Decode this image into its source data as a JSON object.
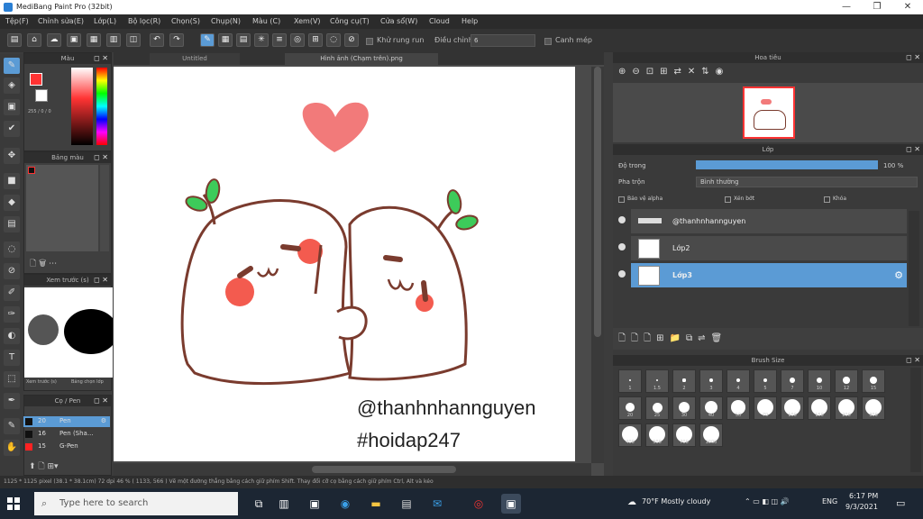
{
  "window": {
    "title": "MediBang Paint Pro (32bit)"
  },
  "menu": [
    "Tệp(F)",
    "Chỉnh sửa(E)",
    "Lớp(L)",
    "Bộ lọc(R)",
    "Chọn(S)",
    "Chụp(N)",
    "Màu (C)",
    "Xem(V)",
    "Công cụ(T)",
    "Cửa sổ(W)",
    "Cloud",
    "Help"
  ],
  "toolbar": {
    "stabilizer_label": "Khử rung run",
    "adjust_label": "Điều chỉnh",
    "adjust_value": "6",
    "grid_label": "Canh mép"
  },
  "panels": {
    "color": {
      "title": "Màu",
      "rgb": "255 / 0 / 0"
    },
    "palette": {
      "title": "Bảng màu"
    },
    "navigator": {
      "title": "Xem trước (s)",
      "tab1": "Xem trước (s)",
      "tab2": "Bảng chọn lớp"
    },
    "brush": {
      "title": "Cọ / Pen",
      "items": [
        {
          "size": "20",
          "name": "Pen"
        },
        {
          "size": "16",
          "name": "Pen (Sha..."
        },
        {
          "size": "15",
          "name": "G-Pen"
        }
      ]
    },
    "nav_right": {
      "title": "Hoa tiêu"
    },
    "layer": {
      "title": "Lớp",
      "opacity_label": "Độ trong",
      "opacity_value": "100 %",
      "blend_label": "Pha trộn",
      "blend_value": "Bình thường",
      "protect_alpha": "Bảo vệ alpha",
      "clipping": "Xén bớt",
      "lock": "Khóa"
    },
    "brush_size": {
      "title": "Brush Size"
    }
  },
  "layers": [
    {
      "name": "@thanhnhannguyen",
      "selected": false
    },
    {
      "name": "Lớp2",
      "selected": false
    },
    {
      "name": "Lớp3",
      "selected": true
    }
  ],
  "brush_sizes": [
    "1",
    "1.5",
    "2",
    "3",
    "4",
    "5",
    "7",
    "10",
    "12",
    "15",
    "20",
    "25",
    "30",
    "40",
    "50",
    "70",
    "100",
    "150",
    "200",
    "300",
    "400",
    "500",
    "700",
    "1000"
  ],
  "doc_tabs": [
    "Untitled",
    "Hình ảnh (Chạm trên).png"
  ],
  "canvas": {
    "text1": "@thanhnhannguyen",
    "text2": "#hoidap247"
  },
  "status": "1125 * 1125 pixel  (38.1 * 38.1cm)  72 dpi  46 %  ( 1133, 566 )  Vẽ một đường thẳng bằng cách giữ phím Shift. Thay đổi cỡ cọ bằng cách giữ phím Ctrl, Alt và kéo",
  "taskbar": {
    "search_placeholder": "Type here to search",
    "weather": "70°F  Mostly cloudy",
    "lang": "ENG",
    "time": "6:17 PM",
    "date": "9/3/2021"
  },
  "colors": {
    "accent": "#5b9bd5",
    "heart": "#f27a7a",
    "leaf": "#3dcb5a",
    "outline": "#7a3b2e"
  }
}
